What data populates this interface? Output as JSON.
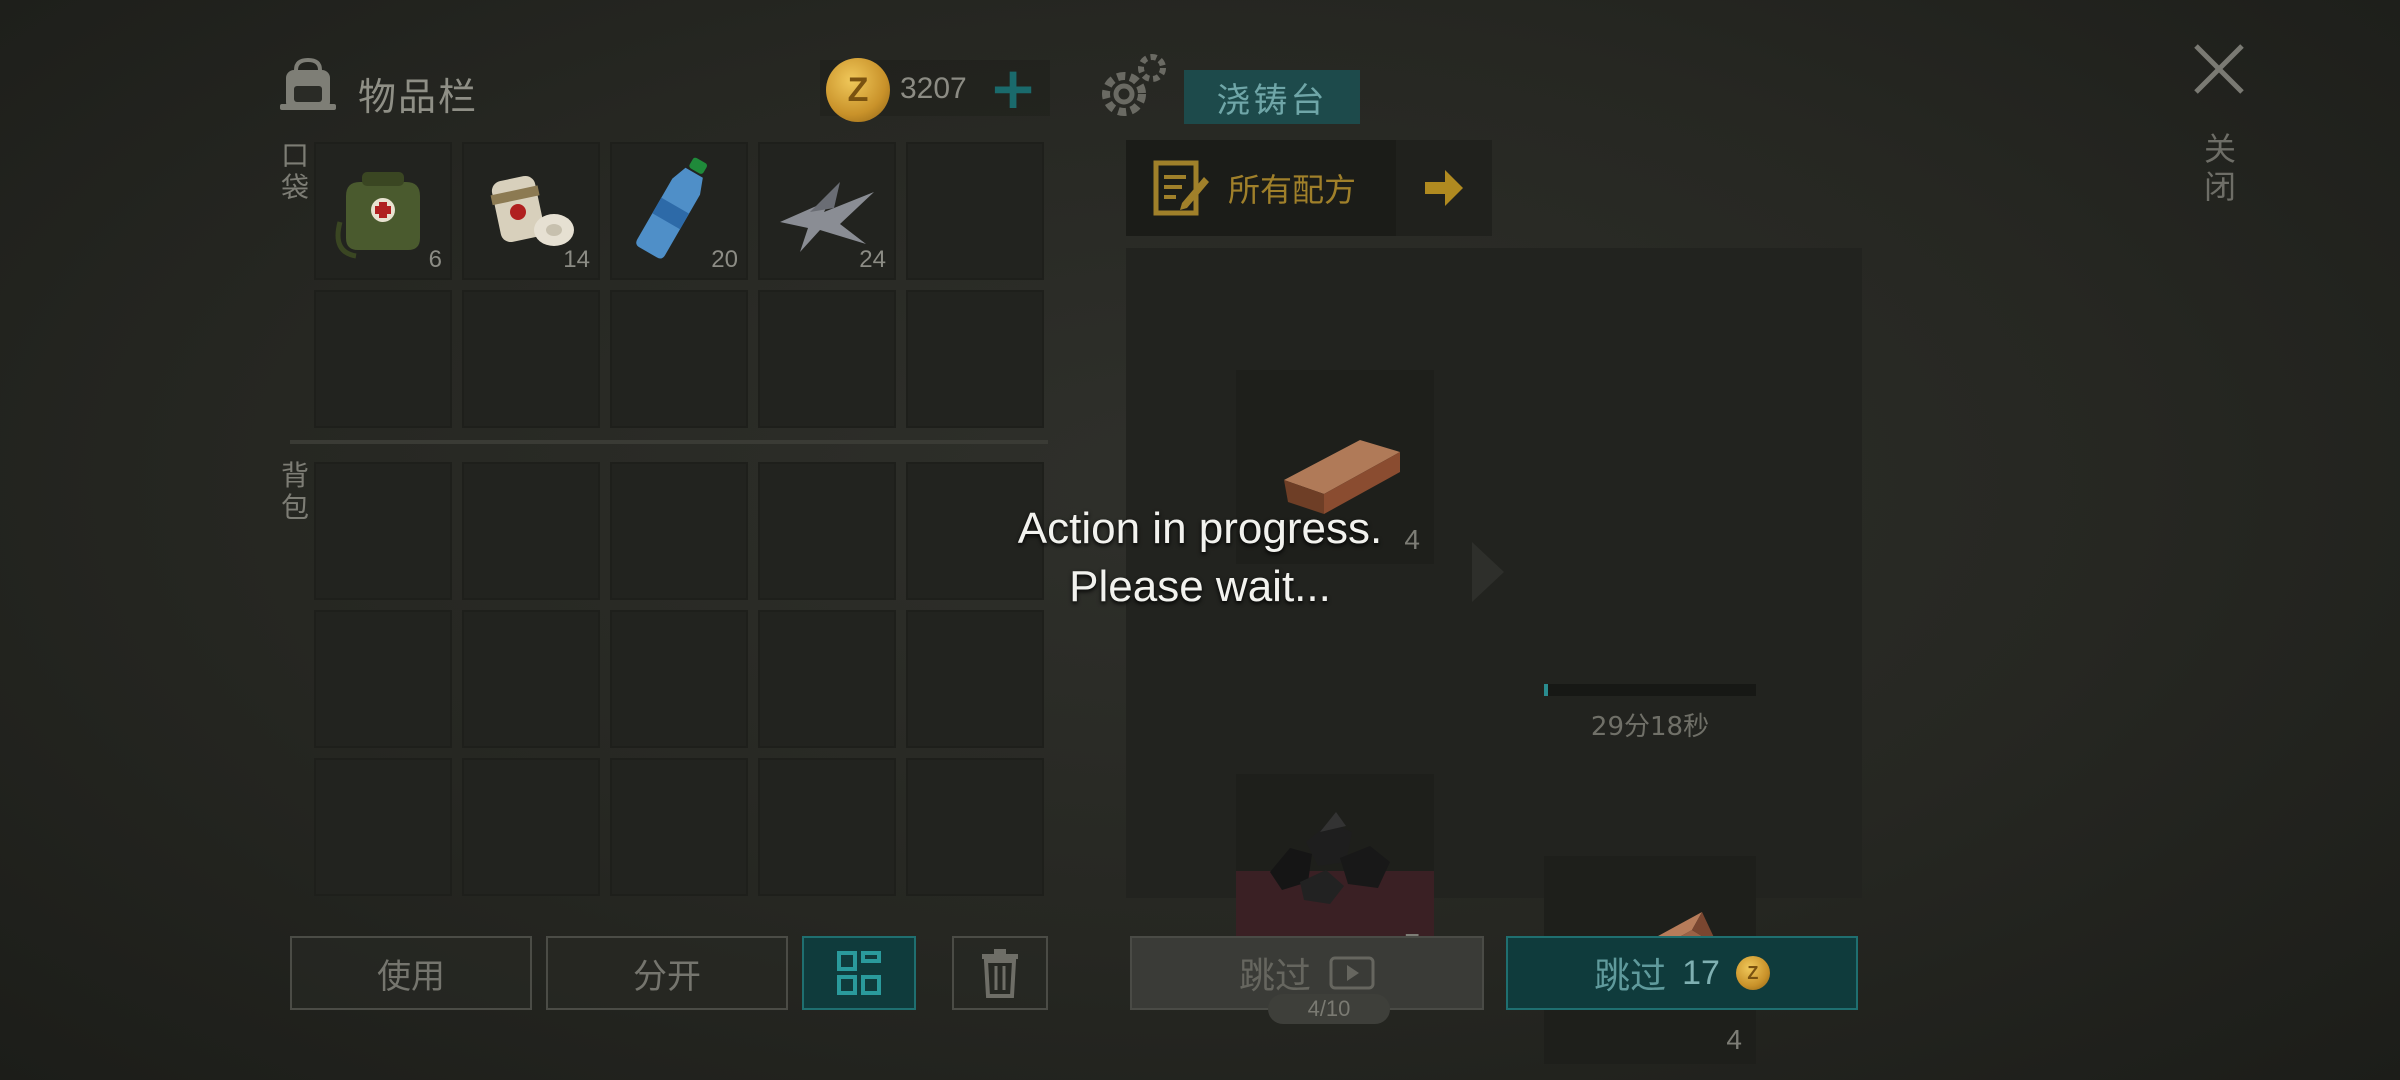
{
  "inventory": {
    "title": "物品栏",
    "coins": "3207",
    "coin_symbol": "Z",
    "pocket_label": "口袋",
    "backpack_label": "背包",
    "pocket_items": [
      {
        "name": "medkit-bag",
        "count": "6"
      },
      {
        "name": "bandage",
        "count": "14"
      },
      {
        "name": "water-bottle",
        "count": "20"
      },
      {
        "name": "scrap-metal",
        "count": "24"
      },
      {
        "name": "empty",
        "count": ""
      }
    ],
    "buttons": {
      "use": "使用",
      "split": "分开"
    }
  },
  "crafting": {
    "station": "浇铸台",
    "recipes_label": "所有配方",
    "ingredients": [
      {
        "name": "copper-ingot",
        "count": "4"
      },
      {
        "name": "coal",
        "count": "7"
      }
    ],
    "result": {
      "name": "copper-bar",
      "count": "4"
    },
    "progress_percent": 2,
    "timer": "29分18秒",
    "skip_ad_label": "跳过",
    "ad_count": "4/10",
    "skip_coin_label": "跳过",
    "skip_coin_cost": "17"
  },
  "close_label": "关闭",
  "overlay": {
    "line1": "Action in progress.",
    "line2": "Please wait..."
  },
  "colors": {
    "accent_teal": "#1f6f70",
    "gold": "#c9922a",
    "background": "#262722"
  }
}
